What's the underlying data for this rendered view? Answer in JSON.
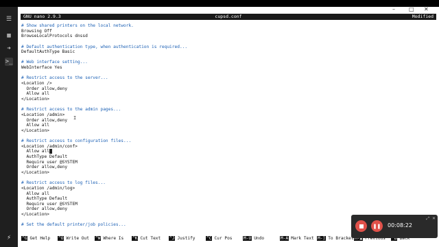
{
  "window": {
    "minimize": "–",
    "maximize": "□",
    "close": "✕"
  },
  "nano": {
    "version": "GNU nano 2.9.3",
    "filename": "cupsd.conf",
    "status": "Modified"
  },
  "editor_lines": [
    {
      "text": "# Show shared printers on the local network.",
      "comment": true
    },
    {
      "text": "Browsing Off",
      "comment": false
    },
    {
      "text": "BrowseLocalProtocols dnssd",
      "comment": false
    },
    {
      "text": "",
      "comment": false
    },
    {
      "text": "# Default authentication type, when authentication is required...",
      "comment": true
    },
    {
      "text": "DefaultAuthType Basic",
      "comment": false
    },
    {
      "text": "",
      "comment": false
    },
    {
      "text": "# Web interface setting...",
      "comment": true
    },
    {
      "text": "WebInterface Yes",
      "comment": false
    },
    {
      "text": "",
      "comment": false
    },
    {
      "text": "# Restrict access to the server...",
      "comment": true
    },
    {
      "text": "<Location />",
      "comment": false
    },
    {
      "text": "  Order allow,deny",
      "comment": false
    },
    {
      "text": "  Allow all",
      "comment": false
    },
    {
      "text": "</Location>",
      "comment": false
    },
    {
      "text": "",
      "comment": false
    },
    {
      "text": "# Restrict access to the admin pages...",
      "comment": true
    },
    {
      "text": "<Location /admin>",
      "comment": false
    },
    {
      "text": "  Order allow,deny",
      "comment": false
    },
    {
      "text": "  Allow all",
      "comment": false
    },
    {
      "text": "</Location>",
      "comment": false
    },
    {
      "text": "",
      "comment": false
    },
    {
      "text": "# Restrict access to configuration files...",
      "comment": true
    },
    {
      "text": "<Location /admin/conf>",
      "comment": false
    },
    {
      "text": "  Allow all",
      "comment": false,
      "cursor": true
    },
    {
      "text": "  AuthType Default",
      "comment": false
    },
    {
      "text": "  Require user @SYSTEM",
      "comment": false
    },
    {
      "text": "  Order allow,deny",
      "comment": false
    },
    {
      "text": "</Location>",
      "comment": false
    },
    {
      "text": "",
      "comment": false
    },
    {
      "text": "# Restrict access to log files...",
      "comment": true
    },
    {
      "text": "<Location /admin/log>",
      "comment": false
    },
    {
      "text": "  Allow all",
      "comment": false
    },
    {
      "text": "  AuthType Default",
      "comment": false
    },
    {
      "text": "  Require user @SYSTEM",
      "comment": false
    },
    {
      "text": "  Order allow,deny",
      "comment": false
    },
    {
      "text": "</Location>",
      "comment": false
    },
    {
      "text": "",
      "comment": false
    },
    {
      "text": "# Set the default printer/job policies...",
      "comment": true
    }
  ],
  "shortcuts": [
    {
      "key": "^G",
      "label": "Get Help"
    },
    {
      "key": "^O",
      "label": "Write Out"
    },
    {
      "key": "^W",
      "label": "Where Is"
    },
    {
      "key": "^K",
      "label": "Cut Text"
    },
    {
      "key": "^J",
      "label": "Justify"
    },
    {
      "key": "^C",
      "label": "Cur Pos"
    },
    {
      "key": "M-U",
      "label": "Undo"
    },
    {
      "key": "M-A",
      "label": "Mark Text"
    },
    {
      "key": "M-]",
      "label": "To Bracket"
    },
    {
      "key": "M-▲",
      "label": "Previous"
    },
    {
      "key": "^B",
      "label": "Back"
    }
  ],
  "recorder": {
    "time": "00:08:22"
  },
  "colors": {
    "comment": "#1a5fb4",
    "recorder_accent": "#e0514a",
    "nano_header": "#1a1a1a"
  }
}
